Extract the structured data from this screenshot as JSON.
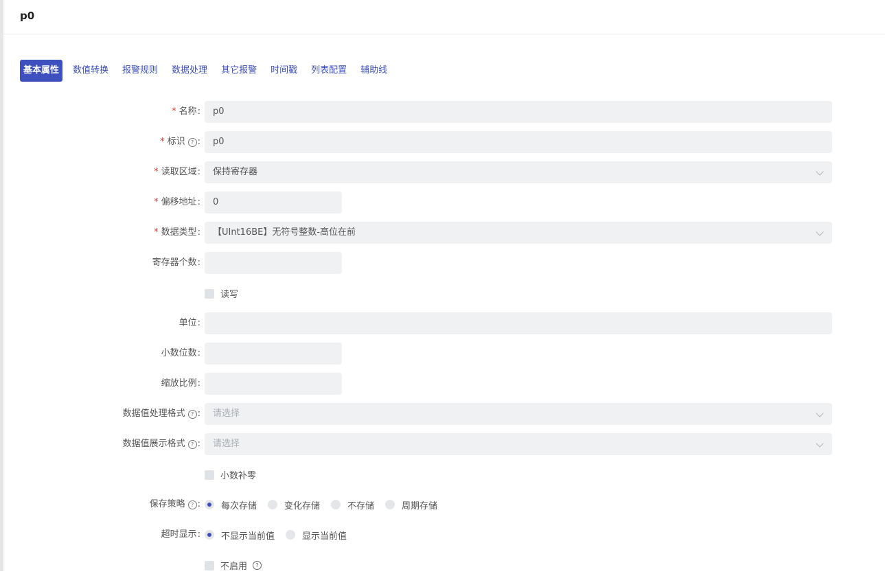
{
  "header": {
    "title": "p0"
  },
  "tabs": [
    {
      "label": "基本属性",
      "active": true
    },
    {
      "label": "数值转换"
    },
    {
      "label": "报警规则"
    },
    {
      "label": "数据处理"
    },
    {
      "label": "其它报警"
    },
    {
      "label": "时间戳"
    },
    {
      "label": "列表配置"
    },
    {
      "label": "辅助线"
    }
  ],
  "form": {
    "name": {
      "label": "名称",
      "value": "p0"
    },
    "identifier": {
      "label": "标识",
      "value": "p0"
    },
    "read_area": {
      "label": "读取区域",
      "value": "保持寄存器"
    },
    "offset": {
      "label": "偏移地址",
      "value": "0"
    },
    "data_type": {
      "label": "数据类型",
      "value": "【UInt16BE】无符号整数-高位在前"
    },
    "register_count": {
      "label": "寄存器个数",
      "value": ""
    },
    "read_write": {
      "label": "读写"
    },
    "unit": {
      "label": "单位",
      "value": ""
    },
    "decimals": {
      "label": "小数位数",
      "value": ""
    },
    "scale": {
      "label": "缩放比例",
      "value": ""
    },
    "process_format": {
      "label": "数据值处理格式",
      "placeholder": "请选择"
    },
    "display_format": {
      "label": "数据值展示格式",
      "placeholder": "请选择"
    },
    "zero_pad": {
      "label": "小数补零"
    },
    "save_strategy": {
      "label": "保存策略",
      "options": [
        "每次存储",
        "变化存储",
        "不存储",
        "周期存储"
      ],
      "selected": 0
    },
    "timeout_display": {
      "label": "超时显示",
      "options": [
        "不显示当前值",
        "显示当前值"
      ],
      "selected": 0
    },
    "disable": {
      "label": "不启用"
    },
    "required_mark": "*",
    "colon": ":",
    "help_glyph": "?"
  }
}
